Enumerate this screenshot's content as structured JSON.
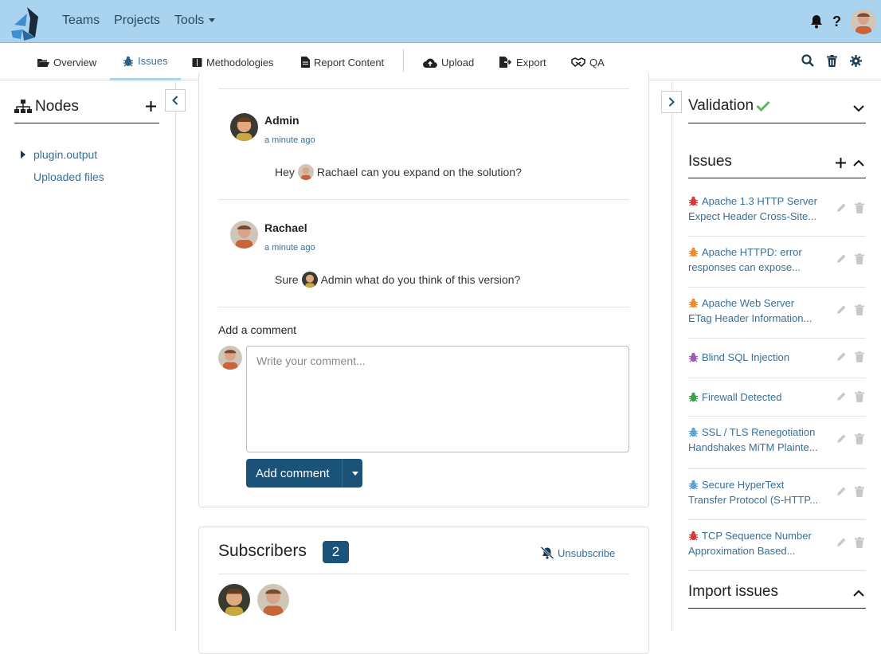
{
  "topnav": {
    "teams": "Teams",
    "projects": "Projects",
    "tools": "Tools"
  },
  "topbar_right": {
    "help": "?"
  },
  "subnav": {
    "tabs": [
      {
        "label": "Overview",
        "icon": "folder-open-icon"
      },
      {
        "label": "Issues",
        "icon": "bug-icon",
        "active": true
      },
      {
        "label": "Methodologies",
        "icon": "book-icon"
      },
      {
        "label": "Report Content",
        "icon": "file-icon"
      },
      {
        "label": "Upload",
        "icon": "cloud-upload-icon"
      },
      {
        "label": "Export",
        "icon": "export-icon"
      },
      {
        "label": "QA",
        "icon": "handshake-icon"
      }
    ]
  },
  "left": {
    "title": "Nodes",
    "nodes": [
      "plugin.output",
      "Uploaded files"
    ]
  },
  "comments": [
    {
      "author": "Admin",
      "time": "a minute ago",
      "prefix": "Hey",
      "mention": "Rachael",
      "text": "can you expand on the solution?"
    },
    {
      "author": "Rachael",
      "time": "a minute ago",
      "prefix": "Sure",
      "mention": "Admin",
      "text": "what do you think of this version?"
    }
  ],
  "add_comment": {
    "label": "Add a comment",
    "placeholder": "Write your comment...",
    "button": "Add comment"
  },
  "subscribers": {
    "title": "Subscribers",
    "count": "2",
    "unsubscribe": "Unsubscribe"
  },
  "right": {
    "validation": "Validation",
    "issues_title": "Issues",
    "import_title": "Import issues",
    "issues": [
      {
        "line1": "Apache 1.3 HTTP Server",
        "line2": "Expect Header Cross-Site...",
        "color": "#d9383a"
      },
      {
        "line1": "Apache HTTPD: error",
        "line2": "responses can expose...",
        "color": "#f08a24"
      },
      {
        "line1": "Apache Web Server",
        "line2": "ETag Header Information...",
        "color": "#f08a24"
      },
      {
        "line1": "Blind SQL Injection",
        "line2": "",
        "color": "#9b59b6"
      },
      {
        "line1": "Firewall Detected",
        "line2": "",
        "color": "#3aa34a"
      },
      {
        "line1": "SSL / TLS Renegotiation",
        "line2": "Handshakes MiTM Plainte...",
        "color": "#5aa6d6"
      },
      {
        "line1": "Secure HyperText",
        "line2": "Transfer Protocol (S-HTTP...",
        "color": "#5aa6d6"
      },
      {
        "line1": "TCP Sequence Number",
        "line2": "Approximation Based...",
        "color": "#d9383a"
      }
    ]
  },
  "colors": {
    "topbar": "#a9d3ef",
    "primary": "#1b5278",
    "link": "#3a6f94",
    "valid": "#5cb85c"
  }
}
